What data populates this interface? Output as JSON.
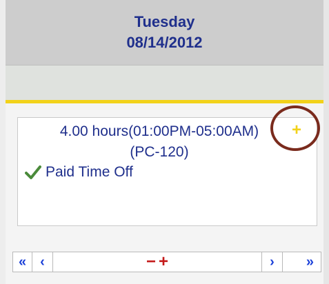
{
  "header": {
    "day": "Tuesday",
    "date": "08/14/2012"
  },
  "entry": {
    "hours_text": "4.00 hours(01:00PM-05:00AM)",
    "code_text": "(PC-120)",
    "type_text": "Paid Time Off",
    "add_icon": "+",
    "status_icon": "check-icon"
  },
  "nav": {
    "first": "«",
    "prev": "‹",
    "minus": "−",
    "plus": "+",
    "next": "›",
    "last": "»"
  },
  "colors": {
    "header_bg": "#cdcdcd",
    "text_blue": "#1f2f8c",
    "accent_yellow": "#f2d21a",
    "check_green": "#4a8a3a",
    "nav_blue": "#1a3fd8",
    "zoom_red": "#c41a1a",
    "highlight_circle": "#7a2b1d"
  }
}
